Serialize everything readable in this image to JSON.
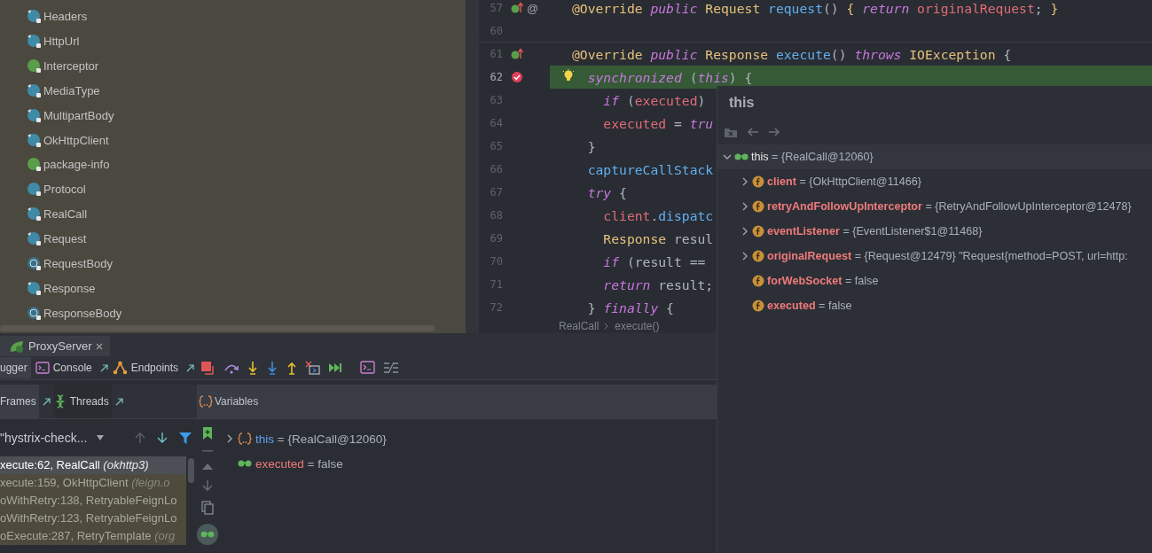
{
  "project_tree": {
    "items": [
      {
        "name": "Headers",
        "kind": "class"
      },
      {
        "name": "HttpUrl",
        "kind": "class"
      },
      {
        "name": "Interceptor",
        "kind": "interface"
      },
      {
        "name": "MediaType",
        "kind": "class"
      },
      {
        "name": "MultipartBody",
        "kind": "class"
      },
      {
        "name": "OkHttpClient",
        "kind": "class"
      },
      {
        "name": "package-info",
        "kind": "interface"
      },
      {
        "name": "Protocol",
        "kind": "enum"
      },
      {
        "name": "RealCall",
        "kind": "class"
      },
      {
        "name": "Request",
        "kind": "class"
      },
      {
        "name": "RequestBody",
        "kind": "abstract"
      },
      {
        "name": "Response",
        "kind": "class"
      },
      {
        "name": "ResponseBody",
        "kind": "abstract"
      }
    ]
  },
  "editor": {
    "lines": [
      {
        "number": "57",
        "current": false,
        "gutter": [
          {
            "kind": "override"
          },
          {
            "kind": "text",
            "text": "@"
          }
        ],
        "segments": [
          {
            "text": "@Override",
            "kind": "type"
          },
          {
            "text": " public",
            "kind": "kw"
          },
          {
            "text": " Request",
            "kind": "type"
          },
          {
            "text": " request",
            "kind": "fn"
          },
          {
            "text": "() ",
            "kind": "plain"
          },
          {
            "text": "{",
            "kind": "type"
          },
          {
            "text": " return",
            "kind": "kw"
          },
          {
            "text": " originalRequest",
            "kind": "field"
          },
          {
            "text": "; ",
            "kind": "plain"
          },
          {
            "text": "}",
            "kind": "type"
          }
        ]
      },
      {
        "number": "60",
        "current": false
      },
      {
        "number": "61",
        "current": false,
        "gutter": [
          {
            "kind": "override"
          }
        ],
        "segments": [
          {
            "text": "@Override",
            "kind": "type"
          },
          {
            "text": " public",
            "kind": "kw"
          },
          {
            "text": " Response",
            "kind": "type"
          },
          {
            "text": " execute",
            "kind": "fn"
          },
          {
            "text": "() ",
            "kind": "plain"
          },
          {
            "text": "throws",
            "kind": "kw"
          },
          {
            "text": " IOException",
            "kind": "type"
          },
          {
            "text": " {",
            "kind": "plain"
          }
        ]
      },
      {
        "number": "62",
        "current": true,
        "gutter": [
          {
            "kind": "breakpoint"
          }
        ],
        "bulb": true,
        "segments": [
          {
            "text": "  synchronized",
            "kind": "kw"
          },
          {
            "text": " (",
            "kind": "plain"
          },
          {
            "text": "this",
            "kind": "kw"
          },
          {
            "text": ") {",
            "kind": "plain"
          }
        ]
      },
      {
        "number": "63",
        "current": false,
        "segments": [
          {
            "text": "    if",
            "kind": "kw"
          },
          {
            "text": " (",
            "kind": "plain"
          },
          {
            "text": "executed",
            "kind": "field"
          },
          {
            "text": ")",
            "kind": "plain"
          }
        ]
      },
      {
        "number": "64",
        "current": false,
        "segments": [
          {
            "text": "    executed",
            "kind": "field"
          },
          {
            "text": " = ",
            "kind": "plain"
          },
          {
            "text": "tru",
            "kind": "kw"
          }
        ]
      },
      {
        "number": "65",
        "current": false,
        "segments": [
          {
            "text": "  }",
            "kind": "plain"
          }
        ]
      },
      {
        "number": "66",
        "current": false,
        "segments": [
          {
            "text": "  captureCallStack",
            "kind": "fn"
          }
        ]
      },
      {
        "number": "67",
        "current": false,
        "segments": [
          {
            "text": "  try",
            "kind": "kw"
          },
          {
            "text": " {",
            "kind": "plain"
          }
        ]
      },
      {
        "number": "68",
        "current": false,
        "segments": [
          {
            "text": "    client",
            "kind": "field"
          },
          {
            "text": ".",
            "kind": "plain"
          },
          {
            "text": "dispatc",
            "kind": "fn"
          }
        ]
      },
      {
        "number": "69",
        "current": false,
        "segments": [
          {
            "text": "    Response",
            "kind": "type"
          },
          {
            "text": " resul",
            "kind": "plain"
          }
        ]
      },
      {
        "number": "70",
        "current": false,
        "segments": [
          {
            "text": "    if",
            "kind": "kw"
          },
          {
            "text": " (result ==",
            "kind": "plain"
          }
        ]
      },
      {
        "number": "71",
        "current": false,
        "segments": [
          {
            "text": "    return",
            "kind": "kw"
          },
          {
            "text": " result;",
            "kind": "plain"
          }
        ]
      },
      {
        "number": "72",
        "current": false,
        "segments": [
          {
            "text": "  } ",
            "kind": "plain"
          },
          {
            "text": "finally",
            "kind": "kw"
          },
          {
            "text": " {",
            "kind": "plain"
          }
        ]
      }
    ],
    "breadcrumb": [
      "RealCall",
      "execute()"
    ]
  },
  "popup": {
    "title": "this",
    "tree": [
      {
        "name": "this",
        "value": "= {RealCall@12060}",
        "kind": "watch",
        "expanded": true,
        "children": [
          {
            "name": "client",
            "value": "= {OkHttpClient@11466}",
            "kind": "field",
            "expanded": false
          },
          {
            "name": "retryAndFollowUpInterceptor",
            "value": "= {RetryAndFollowUpInterceptor@12478}",
            "kind": "field",
            "expanded": false
          },
          {
            "name": "eventListener",
            "value": "= {EventListener$1@11468}",
            "kind": "field",
            "expanded": false
          },
          {
            "name": "originalRequest",
            "value": "= {Request@12479} \"Request{method=POST, url=http:",
            "kind": "field",
            "expanded": false
          },
          {
            "name": "forWebSocket",
            "value": "= false",
            "kind": "field"
          },
          {
            "name": "executed",
            "value": "= false",
            "kind": "field"
          }
        ]
      }
    ]
  },
  "debug": {
    "run_tab": "ProxyServer",
    "tabs": [
      {
        "label": "ugger",
        "kind": "plain",
        "selected": true
      },
      {
        "label": "Console",
        "kind": "console",
        "selected": false
      },
      {
        "label": "Endpoints",
        "kind": "endpoints",
        "selected": false
      }
    ],
    "actions": [
      {
        "kind": "stop"
      },
      {
        "kind": "step-over"
      },
      {
        "kind": "step-into"
      },
      {
        "kind": "force-step-into"
      },
      {
        "kind": "step-out"
      },
      {
        "kind": "drop-frame"
      },
      {
        "kind": "run-to-cursor"
      },
      {
        "kind": "console"
      },
      {
        "kind": "layout"
      }
    ],
    "panel_tabs": [
      {
        "label": "Frames",
        "kind": "plain",
        "selected": true
      },
      {
        "label": "Threads",
        "kind": "threads",
        "selected": false
      }
    ],
    "variables_title": "Variables",
    "thread": "\"hystrix-check...",
    "frames": [
      {
        "method": "xecute:62, RealCall",
        "package": "(okhttp3)",
        "selected": true
      },
      {
        "method": "xecute:159, OkHttpClient",
        "package": "(feign.o",
        "selected": false
      },
      {
        "method": "oWithRetry:138, RetryableFeignLo",
        "selected": false
      },
      {
        "method": "oWithRetry:123, RetryableFeignLo",
        "selected": false
      },
      {
        "method": "oExecute:287, RetryTemplate",
        "package": "(org",
        "selected": false
      }
    ],
    "variables": [
      {
        "name": "this",
        "value": "= {RealCall@12060}",
        "kind": "object",
        "expanded": false
      },
      {
        "name": "executed",
        "value": "= false",
        "kind": "watch"
      }
    ]
  }
}
